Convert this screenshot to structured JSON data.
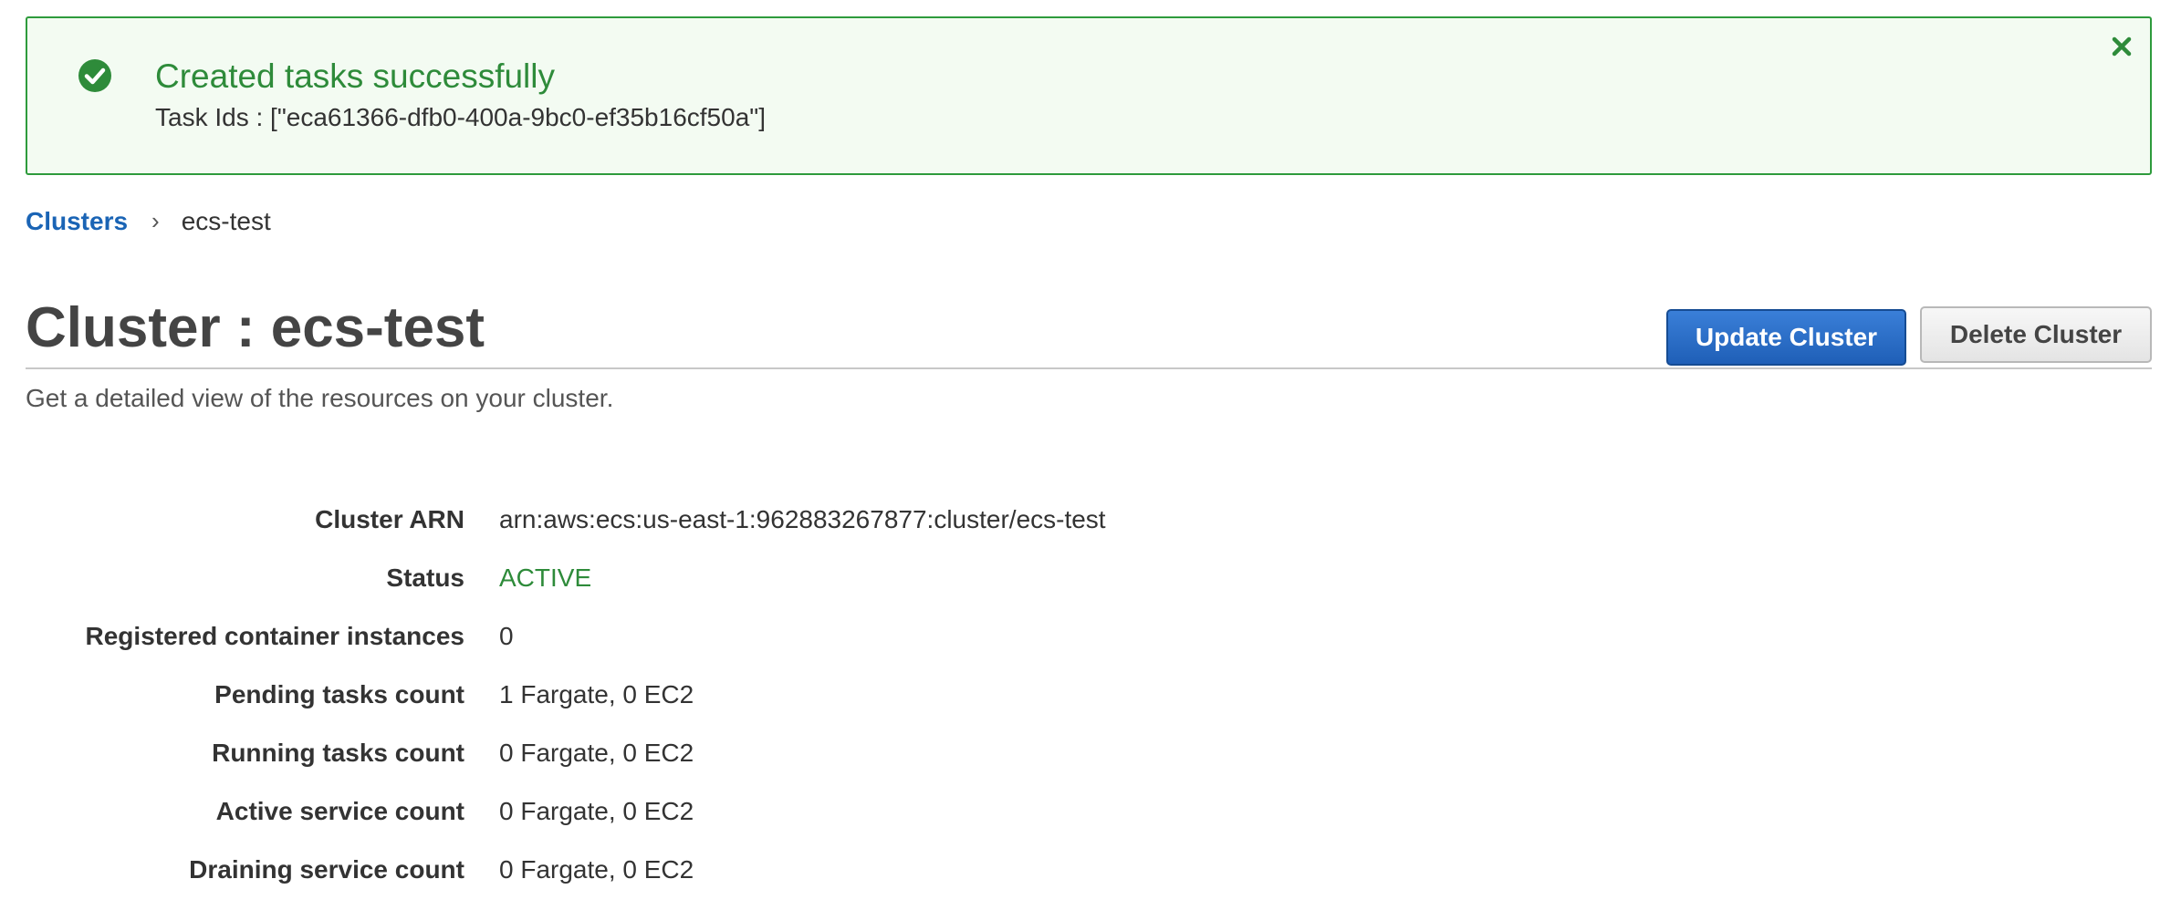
{
  "flash": {
    "title": "Created tasks successfully",
    "message": "Task Ids : [\"eca61366-dfb0-400a-9bc0-ef35b16cf50a\"]"
  },
  "breadcrumb": {
    "parent": "Clusters",
    "separator": "›",
    "current": "ecs-test"
  },
  "header": {
    "title": "Cluster : ecs-test",
    "subtitle": "Get a detailed view of the resources on your cluster.",
    "update_button": "Update Cluster",
    "delete_button": "Delete Cluster"
  },
  "details": [
    {
      "label": "Cluster ARN",
      "value": "arn:aws:ecs:us-east-1:962883267877:cluster/ecs-test"
    },
    {
      "label": "Status",
      "value": "ACTIVE"
    },
    {
      "label": "Registered container instances",
      "value": "0"
    },
    {
      "label": "Pending tasks count",
      "value": "1 Fargate, 0 EC2"
    },
    {
      "label": "Running tasks count",
      "value": "0 Fargate, 0 EC2"
    },
    {
      "label": "Active service count",
      "value": "0 Fargate, 0 EC2"
    },
    {
      "label": "Draining service count",
      "value": "0 Fargate, 0 EC2"
    }
  ],
  "icons": {
    "success": "check-circle-icon",
    "dismiss": "close-icon"
  },
  "colors": {
    "success": "#2e8b3a",
    "link": "#1a64b5",
    "primary_button": "#1f5fb7"
  }
}
